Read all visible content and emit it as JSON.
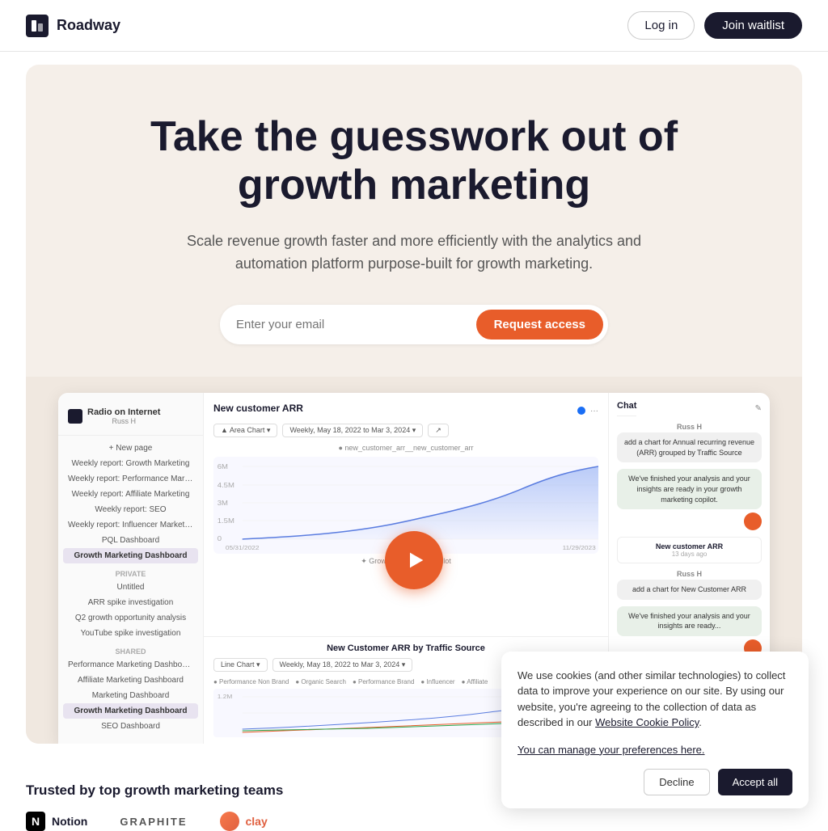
{
  "navbar": {
    "logo_text": "Roadway",
    "login_label": "Log in",
    "join_waitlist_label": "Join waitlist"
  },
  "hero": {
    "title": "Take the guesswork out of growth marketing",
    "subtitle": "Scale revenue growth faster and more efficiently with the analytics and automation platform purpose-built for growth marketing.",
    "email_placeholder": "Enter your email",
    "cta_label": "Request access"
  },
  "dashboard": {
    "user_name": "Russ H",
    "sidebar_items": [
      {
        "label": "New page"
      },
      {
        "label": "Weekly report: Growth Marketing"
      },
      {
        "label": "Weekly report: Performance Marketing"
      },
      {
        "label": "Weekly report: Affiliate Marketing"
      },
      {
        "label": "Weekly report: SEO"
      },
      {
        "label": "Weekly report: Influencer Marketing"
      },
      {
        "label": "PQL Dashboard"
      },
      {
        "label": "Growth Marketing Dashboard",
        "active": true
      }
    ],
    "private_section": "Private",
    "private_items": [
      {
        "label": "Untitled"
      },
      {
        "label": "ARR spike investigation"
      },
      {
        "label": "Q2 growth opportunity analysis"
      },
      {
        "label": "YouTube spike investigation"
      }
    ],
    "shared_section": "Shared",
    "shared_items": [
      {
        "label": "Performance Marketing Dashboard"
      },
      {
        "label": "Affiliate Marketing Dashboard"
      },
      {
        "label": "Marketing Dashboard"
      },
      {
        "label": "Growth Marketing Dashboard",
        "active": true
      },
      {
        "label": "SEO Dashboard"
      }
    ],
    "chart_title": "New customer ARR",
    "chart_date_range": "Weekly, May 18, 2022 to Mar 3, 2024",
    "chart_type": "Area Chart",
    "second_chart_title": "New Customer ARR by Traffic Source",
    "second_chart_type": "Line Chart",
    "second_chart_date_range": "Weekly, May 18, 2022 to Mar 3, 2024",
    "chat_header": "Chat",
    "chat_messages": [
      {
        "user": "Russ H",
        "text": "add a chart for Annual recurring revenue (ARR) grouped by Traffic Source",
        "type": "user"
      },
      {
        "text": "We've finished your analysis and your insights are ready in your growth marketing copilot.",
        "type": "bot"
      },
      {
        "label": "New customer ARR",
        "date": "13 days ago"
      },
      {
        "user": "Russ H",
        "text": "add a chart for New Customer ARR",
        "type": "user"
      },
      {
        "text": "We've finished your analysis and your insights are ready...",
        "type": "bot"
      }
    ]
  },
  "trusted": {
    "title": "Trusted by top growth marketing teams",
    "logos": [
      {
        "name": "Notion",
        "type": "notion"
      },
      {
        "name": "GRAPHITE",
        "type": "graphite"
      },
      {
        "name": "clay",
        "type": "clay"
      }
    ]
  },
  "cookie_banner": {
    "text": "We use cookies (and other similar technologies) to collect data to improve your experience on our site. By using our website, you're agreeing to the collection of data as described in our",
    "policy_link": "Website Cookie Policy",
    "policy_end": ".",
    "manage_link": "You can manage your preferences here.",
    "decline_label": "Decline",
    "accept_label": "Accept all"
  },
  "colors": {
    "accent_orange": "#e85d2a",
    "dark": "#1a1a2e",
    "hero_bg": "#f5efe9"
  }
}
